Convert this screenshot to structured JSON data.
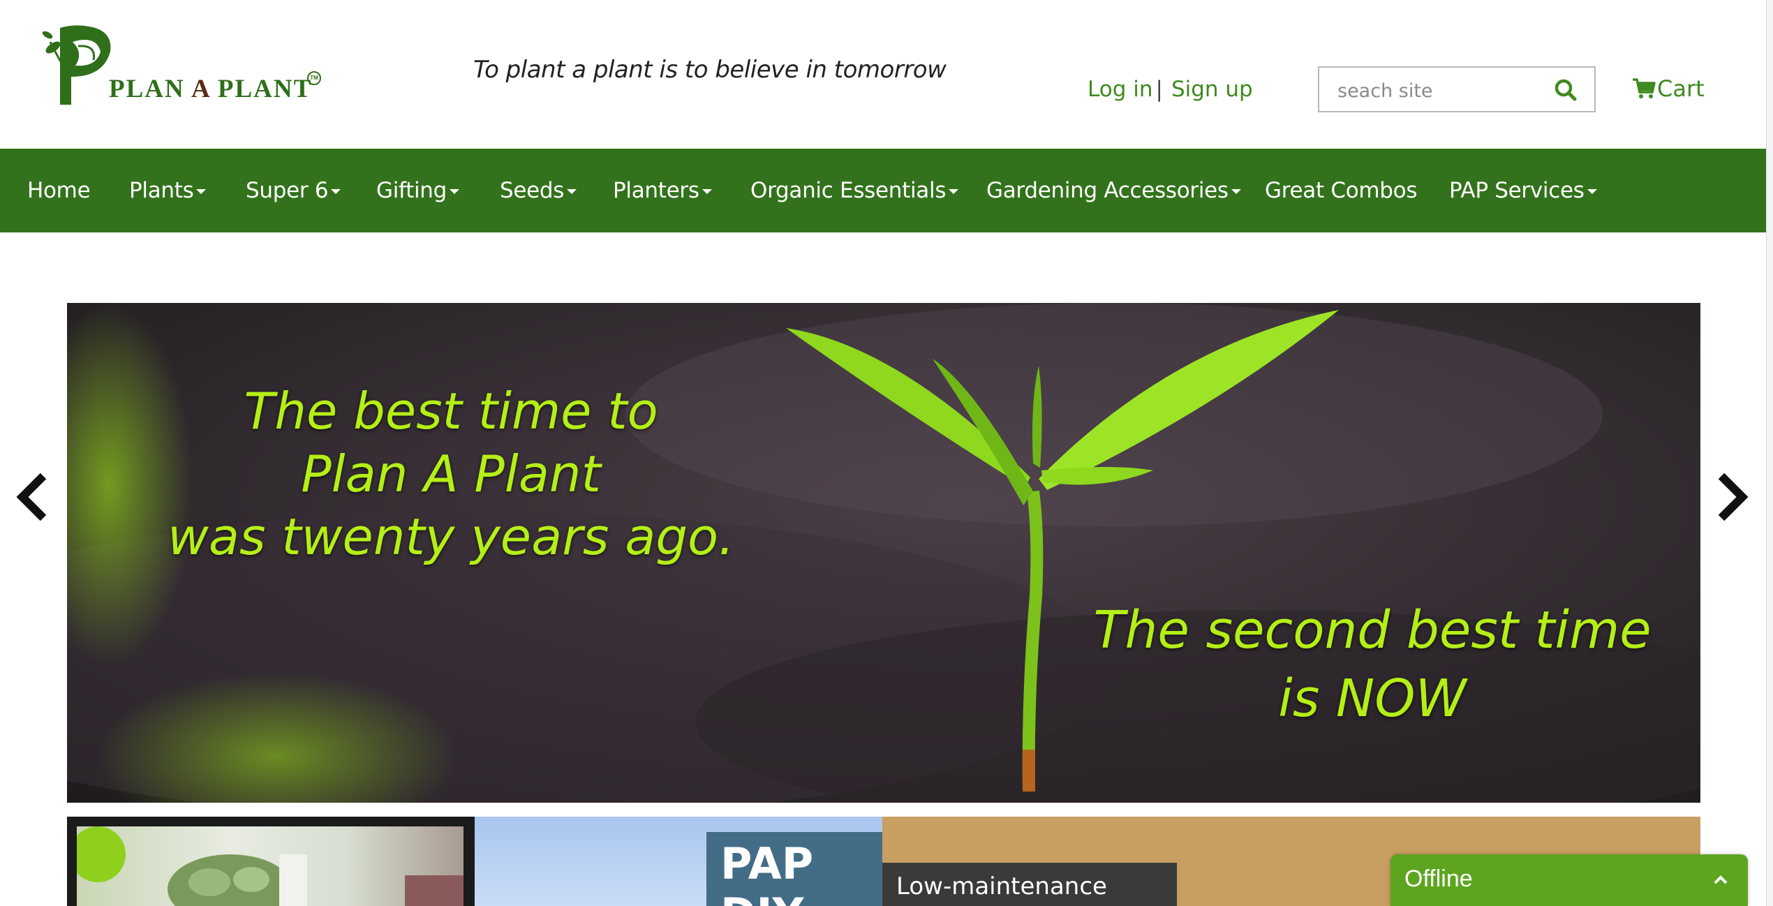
{
  "header": {
    "logo_text": "PLAN A PLANT",
    "logo_tm": "TM",
    "tagline": "To plant a plant is to believe in tomorrow",
    "login_label": "Log in",
    "separator": "|",
    "signup_label": "Sign up",
    "search_placeholder": "seach site",
    "cart_label": "Cart"
  },
  "nav": {
    "items": [
      {
        "label": "Home",
        "dropdown": false
      },
      {
        "label": "Plants",
        "dropdown": true
      },
      {
        "label": "Super 6",
        "dropdown": true
      },
      {
        "label": "Gifting",
        "dropdown": true
      },
      {
        "label": "Seeds",
        "dropdown": true
      },
      {
        "label": "Planters",
        "dropdown": true
      },
      {
        "label": "Organic Essentials",
        "dropdown": true
      },
      {
        "label": "Gardening Accessories",
        "dropdown": true
      },
      {
        "label": "Great Combos",
        "dropdown": false
      },
      {
        "label": "PAP Services",
        "dropdown": true
      }
    ]
  },
  "hero": {
    "line1": "The best time to",
    "line2": "Plan A Plant",
    "line3": "was twenty years ago.",
    "line4": "The second best time",
    "line5": "is NOW"
  },
  "tiles": {
    "pap_line1": "PAP",
    "pap_line2": "DIY",
    "low_maintenance": "Low-maintenance"
  },
  "chat": {
    "status": "Offline"
  },
  "colors": {
    "nav_green": "#33721c",
    "link_green": "#3f8a1e",
    "hero_text": "#b4ef16",
    "chat_green": "#5da51f"
  },
  "icons": {
    "search": "search-icon",
    "cart": "cart-icon",
    "prev": "chevron-left-icon",
    "next": "chevron-right-icon",
    "chat_toggle": "chevron-up-icon"
  }
}
